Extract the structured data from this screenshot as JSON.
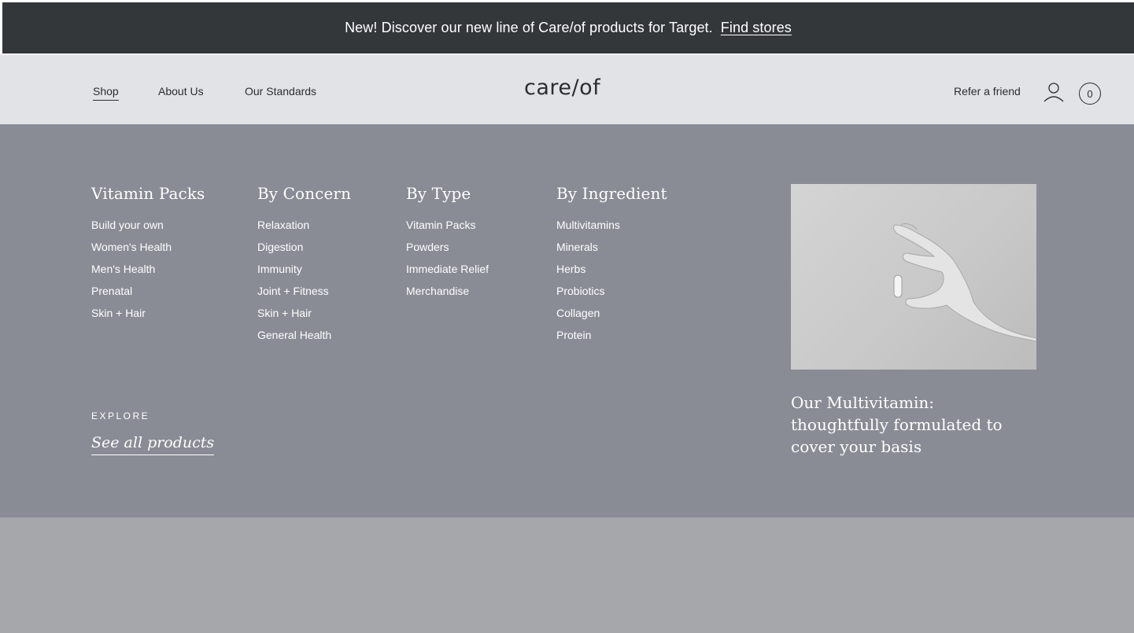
{
  "announcement": {
    "text": "New! Discover our new line of Care/of products for Target.",
    "link": "Find stores"
  },
  "nav": {
    "links": [
      {
        "label": "Shop",
        "active": true
      },
      {
        "label": "About Us"
      },
      {
        "label": "Our Standards"
      }
    ],
    "logo": "care/of",
    "refer": "Refer a friend",
    "cart_count": "0",
    "icons": [
      "user-icon",
      "cart-icon"
    ]
  },
  "menu": {
    "columns": [
      {
        "title": "Vitamin Packs",
        "items": [
          "Build your own",
          "Women's Health",
          "Men's Health",
          "Prenatal",
          "Skin + Hair"
        ]
      },
      {
        "title": "By Concern",
        "items": [
          "Relaxation",
          "Digestion",
          "Immunity",
          "Joint + Fitness",
          "Skin + Hair",
          "General Health"
        ]
      },
      {
        "title": "By Type",
        "items": [
          "Vitamin Packs",
          "Powders",
          "Immediate Relief",
          "Merchandise"
        ]
      },
      {
        "title": "By Ingredient",
        "items": [
          "Multivitamins",
          "Minerals",
          "Herbs",
          "Probiotics",
          "Collagen",
          "Protein"
        ]
      }
    ],
    "explore_label": "EXPLORE",
    "see_all": "See all products",
    "promo": {
      "caption": "Our Multivitamin: thoughtfully formulated to cover your basis"
    }
  },
  "colors": {
    "announcement_bg": "#34373a",
    "nav_bg": "#e2e3e7",
    "menu_bg": "#898c95",
    "page_overlay": "#a6a7ab"
  }
}
